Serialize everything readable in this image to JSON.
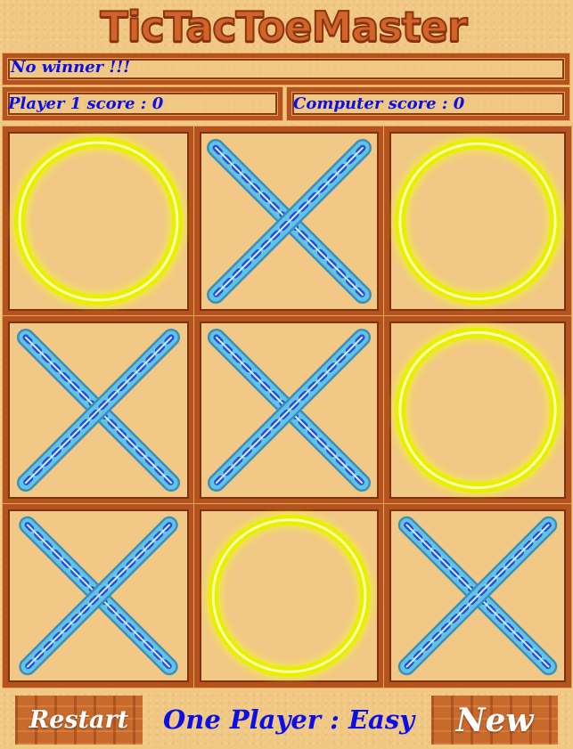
{
  "app": {
    "title": "TicTacToeMaster"
  },
  "status": {
    "message": "No winner !!!"
  },
  "scores": {
    "player1_label": "Player 1 score : 0",
    "computer_label": "Computer score : 0",
    "player1": 0,
    "computer": 0
  },
  "board": {
    "cells": [
      "O",
      "X",
      "O",
      "X",
      "X",
      "O",
      "X",
      "O",
      "X"
    ],
    "colors": {
      "o_glow": "#f4ff2a",
      "x_primary": "#5fc4e8",
      "x_accent": "#2a4fd6",
      "frame": "#b5531e"
    }
  },
  "controls": {
    "restart_label": "Restart",
    "mode_label": "One Player : Easy",
    "new_label": "New"
  }
}
